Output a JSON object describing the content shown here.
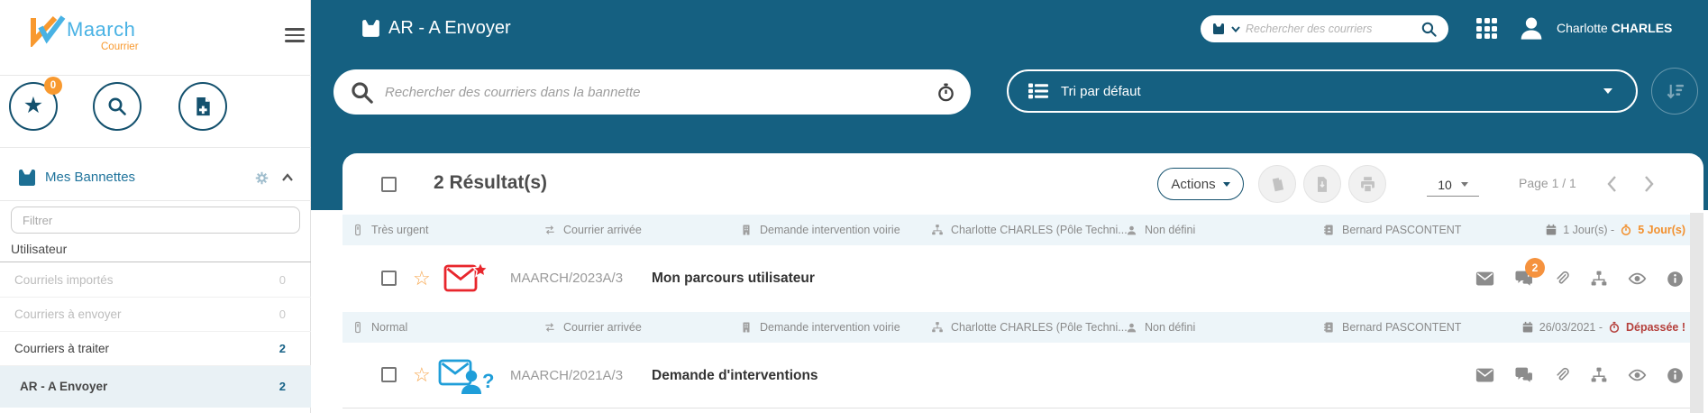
{
  "app": {
    "brand": "Maarch",
    "product": "Courrier"
  },
  "sidebar": {
    "favorites_badge": "0",
    "panel_title": "Mes Bannettes",
    "filter_placeholder": "Filtrer",
    "group_label": "Utilisateur",
    "items": [
      {
        "label": "Courriels importés",
        "count": "0"
      },
      {
        "label": "Courriers à envoyer",
        "count": "0"
      },
      {
        "label": "Courriers à traiter",
        "count": "2"
      },
      {
        "label": "AR - A Envoyer",
        "count": "2"
      }
    ]
  },
  "header": {
    "title": "AR - A Envoyer",
    "search_placeholder": "Rechercher des courriers",
    "user_first": "Charlotte",
    "user_last": "CHARLES"
  },
  "toolbar": {
    "search_placeholder": "Rechercher des courriers dans la bannette",
    "sort_label": "Tri par défaut"
  },
  "results_bar": {
    "count": "2 Résultat(s)",
    "actions_label": "Actions",
    "page_size": "10",
    "page_label": "Page 1 / 1"
  },
  "rows": [
    {
      "priority": "Très urgent",
      "category": "Courrier arrivée",
      "subject_type": "Demande intervention voirie",
      "entity": "Charlotte CHARLES (Pôle Techni...",
      "status": "Non défini",
      "recipient": "Bernard PASCONTENT",
      "deadline_prefix": "1 Jour(s) -",
      "deadline_alert": "5 Jour(s)",
      "reference": "MAARCH/2023A/3",
      "subject": "Mon parcours utilisateur",
      "messages_badge": "2"
    },
    {
      "priority": "Normal",
      "category": "Courrier arrivée",
      "subject_type": "Demande intervention voirie",
      "entity": "Charlotte CHARLES (Pôle Techni...",
      "status": "Non défini",
      "recipient": "Bernard PASCONTENT",
      "deadline_prefix": "26/03/2021 -",
      "deadline_alert": "Dépassée !",
      "reference": "MAARCH/2021A/3",
      "subject": "Demande d'interventions"
    }
  ],
  "colors": {
    "header_teal": "#156081",
    "button_teal": "#14516e",
    "accent_orange": "#f8992f",
    "deadline_orange": "#f2902e",
    "alert_red": "#b5403c",
    "brand_blue": "#49b2e4",
    "mail_red": "#e8262c",
    "mail_blue": "#1f9ed9",
    "selected_bg": "#e9f1f5",
    "meta_bg": "#edf5f9"
  }
}
